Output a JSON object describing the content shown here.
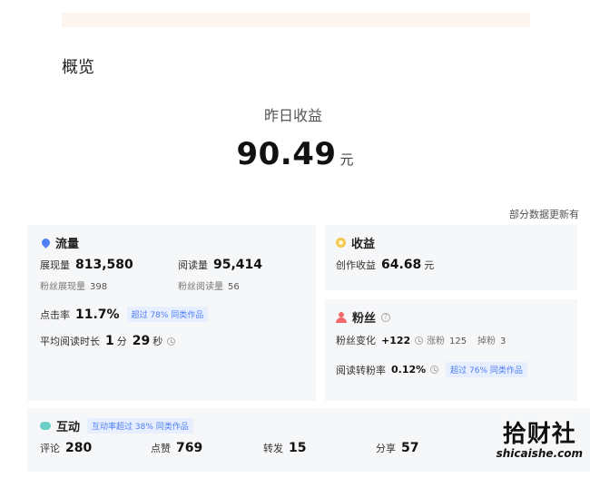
{
  "overview": {
    "title": "概览"
  },
  "yesterday": {
    "label": "昨日收益",
    "amount": "90.49",
    "unit": "元"
  },
  "update_note": "部分数据更新有",
  "traffic": {
    "title": "流量",
    "impressions_label": "展现量",
    "impressions_value": "813,580",
    "reads_label": "阅读量",
    "reads_value": "95,414",
    "fan_impressions_label": "粉丝展现量",
    "fan_impressions_value": "398",
    "fan_reads_label": "粉丝阅读量",
    "fan_reads_value": "56",
    "ctr_label": "点击率",
    "ctr_value": "11.7%",
    "ctr_badge": "超过 78% 同类作品",
    "avg_read_label": "平均阅读时长",
    "avg_read_min": "1",
    "min_unit": "分",
    "avg_read_sec": "29",
    "sec_unit": "秒"
  },
  "income": {
    "title": "收益",
    "creation_label": "创作收益",
    "creation_value": "64.68",
    "creation_unit": "元"
  },
  "fans": {
    "title": "粉丝",
    "change_label": "粉丝变化",
    "change_value": "+122",
    "gain_label": "涨粉",
    "gain_value": "125",
    "loss_label": "掉粉",
    "loss_value": "3",
    "conv_label": "阅读转粉率",
    "conv_value": "0.12%",
    "conv_badge": "超过 76% 同类作品"
  },
  "interaction": {
    "title": "互动",
    "badge": "互动率超过 38% 同类作品",
    "comments_label": "评论",
    "comments_value": "280",
    "likes_label": "点赞",
    "likes_value": "769",
    "shares_label": "转发",
    "shares_value": "15",
    "share_label": "分享",
    "share_value": "57"
  },
  "watermark": {
    "cn": "拾财社",
    "en": "shicaishe.com"
  },
  "colors": {
    "accent_blue": "#4f7ff5",
    "badge_bg": "#e7eefe",
    "card_bg": "#f6f7f9",
    "top_strip": "#fcf5f0"
  }
}
